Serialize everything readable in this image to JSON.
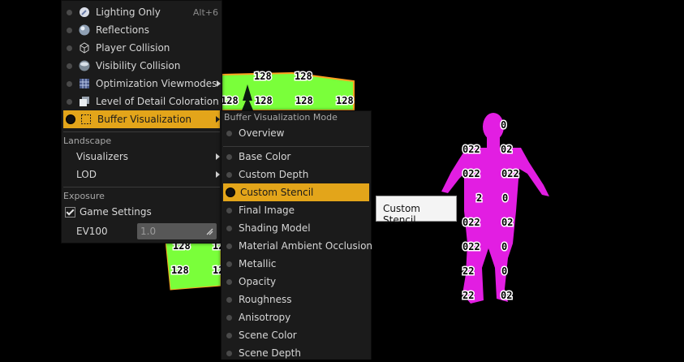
{
  "viewport": {
    "plane_tags": [
      "128",
      "128",
      "128",
      "128",
      "128",
      "128",
      "128",
      "128",
      "128",
      "128"
    ],
    "figure_tags": [
      "0",
      "022",
      "02",
      "022",
      "022",
      "2",
      "0",
      "022",
      "02",
      "022",
      "0",
      "22",
      "0",
      "22",
      "02"
    ],
    "colors": {
      "plane": "#7aff3a",
      "figure": "#e21ee2",
      "accent": "#e3a51a"
    }
  },
  "main_menu": {
    "items": [
      {
        "label": "Lighting Only",
        "shortcut": "Alt+6",
        "icon": "lighting-icon"
      },
      {
        "label": "Reflections",
        "icon": "reflection-sphere-icon"
      },
      {
        "label": "Player Collision",
        "icon": "collision-cube-icon"
      },
      {
        "label": "Visibility Collision",
        "icon": "visibility-sphere-icon"
      },
      {
        "label": "Optimization Viewmodes",
        "icon": "grid-icon"
      },
      {
        "label": "Level of Detail Coloration",
        "icon": "lod-icon"
      },
      {
        "label": "Buffer Visualization",
        "icon": "buffer-icon"
      }
    ],
    "landscape": {
      "header": "Landscape",
      "visualizers": "Visualizers",
      "lod": "LOD"
    },
    "exposure": {
      "header": "Exposure",
      "game_settings": "Game Settings",
      "ev100_label": "EV100",
      "ev100_value": "1.0"
    }
  },
  "sub_menu": {
    "header": "Buffer Visualization Mode",
    "items": [
      "Overview",
      "Base Color",
      "Custom Depth",
      "Custom Stencil",
      "Final Image",
      "Shading Model",
      "Material Ambient Occlusion",
      "Metallic",
      "Opacity",
      "Roughness",
      "Anisotropy",
      "Scene Color",
      "Scene Depth"
    ]
  },
  "tooltip": {
    "text": "Custom Stencil"
  }
}
